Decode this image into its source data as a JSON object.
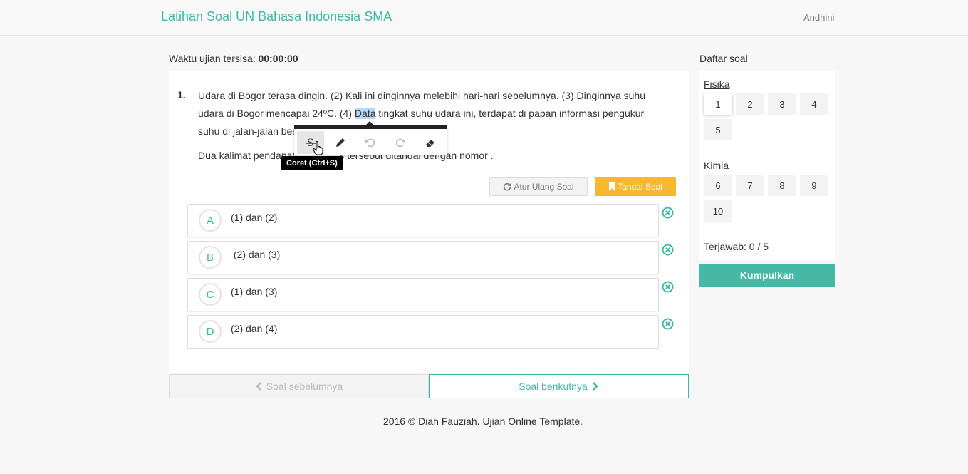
{
  "header": {
    "brand": "Latihan Soal UN Bahasa Indonesia SMA",
    "user": "Andhini"
  },
  "timer": {
    "label": "Waktu ujian tersisa:",
    "value": "00:00:00"
  },
  "question": {
    "number": "1.",
    "text_before": "Udara di Bogor terasa dingin. (2) Kali ini dinginnya melebihi hari-hari sebelumnya. (3) Dinginnya suhu udara di Bogor mencapai 24ºC. (4) ",
    "highlighted": "Data",
    "text_after": " tingkat suhu udara ini, terdapat di papan informasi pengukur suhu di jalan-jalan besar.",
    "prompt_visible_start": "Dua kalimat pendapat",
    "prompt_visible_end": "s tersebut ditandai dengan nomor ."
  },
  "toolbar": {
    "tooltip": "Coret (Ctrl+S)"
  },
  "actions": {
    "reset_label": "Atur Ulang Soal",
    "mark_label": "Tandai Soal"
  },
  "options": [
    {
      "letter": "A",
      "text": "(1) dan (2)"
    },
    {
      "letter": "B",
      "text": " (2) dan (3)"
    },
    {
      "letter": "C",
      "text": "(1) dan (3)"
    },
    {
      "letter": "D",
      "text": "(2) dan (4)"
    }
  ],
  "navigation": {
    "prev_label": "Soal sebelumnya",
    "next_label": "Soal berikutnya"
  },
  "footer": "2016 © Diah Fauziah. Ujian Online Template.",
  "sidebar": {
    "title": "Daftar soal",
    "subjects": [
      {
        "name": "Fisika",
        "questions": [
          "1",
          "2",
          "3",
          "4",
          "5"
        ]
      },
      {
        "name": "Kimia",
        "questions": [
          "6",
          "7",
          "8",
          "9",
          "10"
        ]
      }
    ],
    "answered": "Terjawab: 0 / 5",
    "submit_label": "Kumpulkan"
  },
  "colors": {
    "accent": "#3eb8a4",
    "warning": "#f7b733",
    "highlight": "#b8d6f5"
  }
}
